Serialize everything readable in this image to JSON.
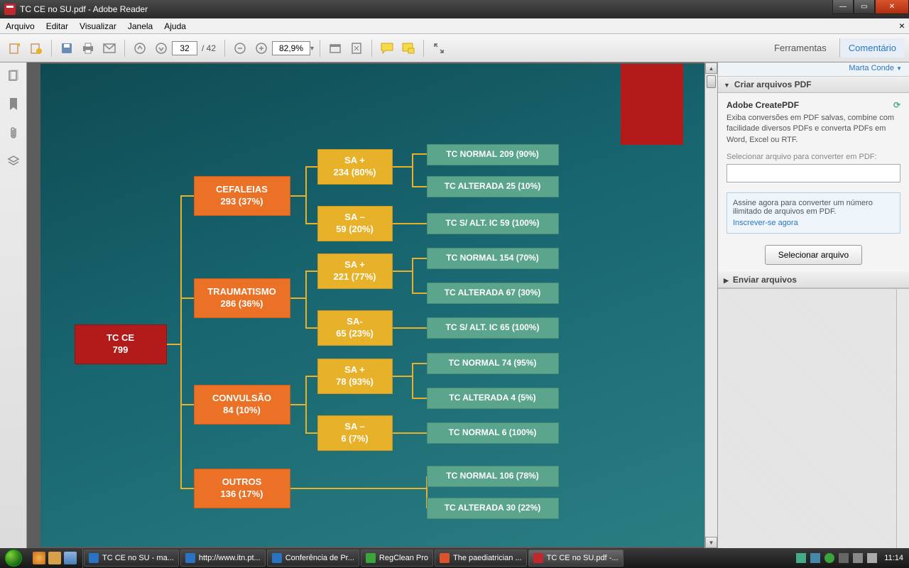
{
  "window": {
    "title": "TC CE no SU.pdf - Adobe Reader"
  },
  "menu": {
    "items": [
      "Arquivo",
      "Editar",
      "Visualizar",
      "Janela",
      "Ajuda"
    ]
  },
  "toolbar": {
    "page_current": "32",
    "page_total": "/ 42",
    "zoom": "82,9%",
    "tools": "Ferramentas",
    "comment": "Comentário"
  },
  "sidebar": {
    "user": "Marta Conde",
    "create_header": "Criar arquivos PDF",
    "create_title": "Adobe CreatePDF",
    "create_desc": "Exiba conversões em PDF salvas, combine com facilidade diversos PDFs e converta PDFs em Word, Excel ou RTF.",
    "select_label": "Selecionar arquivo para converter em PDF:",
    "promo_text": "Assine agora para converter um número ilimitado de arquivos em PDF.",
    "promo_link": "Inscrever-se agora",
    "select_button": "Selecionar arquivo",
    "send_header": "Enviar arquivos"
  },
  "slide": {
    "root": {
      "l1": "TC CE",
      "l2": "799"
    },
    "level2": [
      {
        "l1": "CEFALEIAS",
        "l2": "293 (37%)"
      },
      {
        "l1": "TRAUMATISMO",
        "l2": "286 (36%)"
      },
      {
        "l1": "CONVULSÃO",
        "l2": "84 (10%)"
      },
      {
        "l1": "OUTROS",
        "l2": "136 (17%)"
      }
    ],
    "level3": [
      {
        "l1": "SA +",
        "l2": "234 (80%)"
      },
      {
        "l1": "SA –",
        "l2": "59 (20%)"
      },
      {
        "l1": "SA +",
        "l2": "221 (77%)"
      },
      {
        "l1": "SA-",
        "l2": "65 (23%)"
      },
      {
        "l1": "SA +",
        "l2": "78 (93%)"
      },
      {
        "l1": "SA –",
        "l2": "6 (7%)"
      }
    ],
    "level4": [
      "TC NORMAL 209 (90%)",
      "TC ALTERADA 25 (10%)",
      "TC S/ ALT. IC 59 (100%)",
      "TC NORMAL 154 (70%)",
      "TC ALTERADA 67 (30%)",
      "TC S/ ALT. IC 65 (100%)",
      "TC NORMAL 74 (95%)",
      "TC ALTERADA 4 (5%)",
      "TC NORMAL 6 (100%)",
      "TC NORMAL 106 (78%)",
      "TC ALTERADA 30 (22%)"
    ]
  },
  "taskbar": {
    "items": [
      "TC CE no SU - ma...",
      "http://www.itn.pt...",
      "Conferência de Pr...",
      "RegClean Pro",
      "The paediatrician ...",
      "TC CE no SU.pdf -..."
    ],
    "clock": "11:14"
  }
}
